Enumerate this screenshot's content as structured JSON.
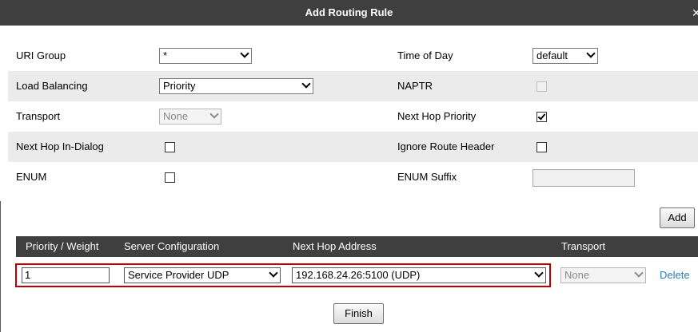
{
  "dialog": {
    "title": "Add Routing Rule"
  },
  "form": {
    "uri_group": {
      "label": "URI Group",
      "value": "*"
    },
    "time_of_day": {
      "label": "Time of Day",
      "value": "default"
    },
    "load_balancing": {
      "label": "Load Balancing",
      "value": "Priority"
    },
    "naptr": {
      "label": "NAPTR",
      "checked": false,
      "disabled": true
    },
    "transport": {
      "label": "Transport",
      "value": "None",
      "disabled": true
    },
    "next_hop_priority": {
      "label": "Next Hop Priority",
      "checked": true
    },
    "next_hop_in_dialog": {
      "label": "Next Hop In-Dialog",
      "checked": false
    },
    "ignore_route_header": {
      "label": "Ignore Route Header",
      "checked": false
    },
    "enum": {
      "label": "ENUM",
      "checked": false
    },
    "enum_suffix": {
      "label": "ENUM Suffix",
      "value": ""
    }
  },
  "add_label": "Add",
  "table": {
    "headers": [
      "Priority / Weight",
      "Server Configuration",
      "Next Hop Address",
      "Transport"
    ],
    "rows": [
      {
        "priority": "1",
        "server_configuration": "Service Provider UDP",
        "next_hop_address": "192.168.24.26:5100 (UDP)",
        "transport": "None",
        "delete_label": "Delete"
      }
    ]
  },
  "finish_label": "Finish"
}
